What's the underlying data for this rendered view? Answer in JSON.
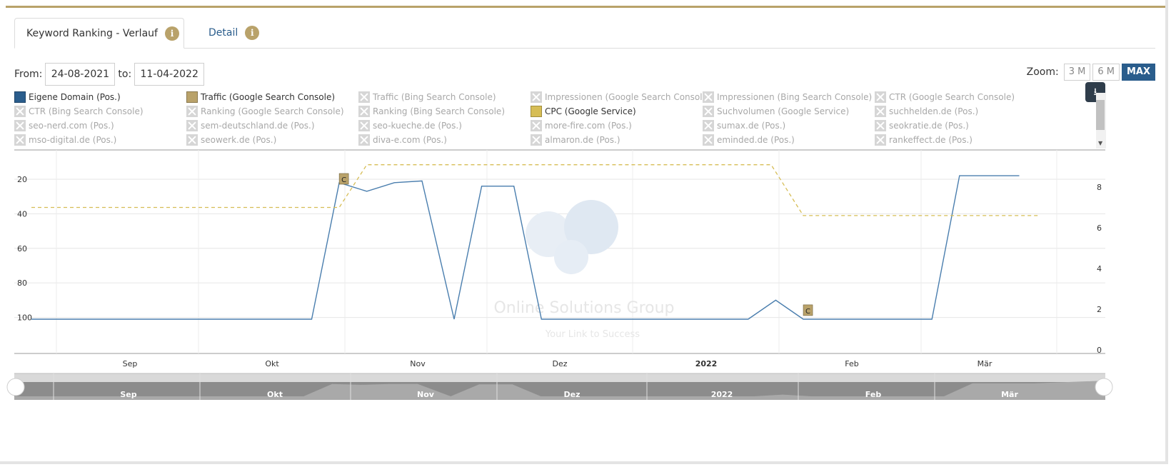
{
  "tabs": [
    {
      "label": "Keyword Ranking - Verlauf",
      "info": "i"
    },
    {
      "label": "Detail",
      "info": "i"
    }
  ],
  "dates": {
    "from_label": "From:",
    "from": "24-08-2021",
    "to_label": "to:",
    "to": "11-04-2022"
  },
  "zoom": {
    "label": "Zoom:",
    "options": [
      "3 M",
      "6 M",
      "MAX"
    ],
    "selected": "MAX"
  },
  "legend": [
    {
      "label": "Eigene Domain (Pos.)",
      "enabled": true,
      "color": "#2a5d8c"
    },
    {
      "label": "Traffic (Google Search Console)",
      "enabled": true,
      "color": "#b9a26a"
    },
    {
      "label": "Traffic (Bing Search Console)",
      "enabled": false
    },
    {
      "label": "Impressionen (Google Search Console)",
      "enabled": false
    },
    {
      "label": "Impressionen (Bing Search Console)",
      "enabled": false
    },
    {
      "label": "CTR (Google Search Console)",
      "enabled": false
    },
    {
      "label": "CTR (Bing Search Console)",
      "enabled": false
    },
    {
      "label": "Ranking (Google Search Console)",
      "enabled": false
    },
    {
      "label": "Ranking (Bing Search Console)",
      "enabled": false
    },
    {
      "label": "CPC (Google Service)",
      "enabled": true,
      "color": "#d6bd55"
    },
    {
      "label": "Suchvolumen (Google Service)",
      "enabled": false
    },
    {
      "label": "suchhelden.de (Pos.)",
      "enabled": false
    },
    {
      "label": "seo-nerd.com (Pos.)",
      "enabled": false
    },
    {
      "label": "sem-deutschland.de (Pos.)",
      "enabled": false
    },
    {
      "label": "seo-kueche.de (Pos.)",
      "enabled": false
    },
    {
      "label": "more-fire.com (Pos.)",
      "enabled": false
    },
    {
      "label": "sumax.de (Pos.)",
      "enabled": false
    },
    {
      "label": "seokratie.de (Pos.)",
      "enabled": false
    },
    {
      "label": "mso-digital.de (Pos.)",
      "enabled": false
    },
    {
      "label": "seowerk.de (Pos.)",
      "enabled": false
    },
    {
      "label": "diva-e.com (Pos.)",
      "enabled": false
    },
    {
      "label": "almaron.de (Pos.)",
      "enabled": false
    },
    {
      "label": "eminded.de (Pos.)",
      "enabled": false
    },
    {
      "label": "rankeffect.de (Pos.)",
      "enabled": false
    }
  ],
  "download_icon": "download-icon",
  "watermark": {
    "line1": "Online Solutions Group",
    "line2": "Your Link to Success"
  },
  "chart_data": {
    "type": "line",
    "x_axis": {
      "type": "date",
      "range": [
        "2021-08-24",
        "2022-04-11"
      ],
      "ticks": [
        "Sep",
        "Okt",
        "Nov",
        "Dez",
        "2022",
        "Feb",
        "Mär"
      ],
      "bold_ticks": [
        "2022"
      ]
    },
    "y_left": {
      "reversed": true,
      "range": [
        1,
        120
      ],
      "ticks": [
        20,
        40,
        60,
        80,
        100
      ]
    },
    "y_right": {
      "range": [
        0,
        9.5
      ],
      "ticks": [
        0,
        2,
        4,
        6,
        8
      ]
    },
    "series": [
      {
        "name": "Eigene Domain (Pos.)",
        "axis": "left",
        "color": "#4a7eae",
        "style": "solid",
        "points": [
          [
            "2021-08-24",
            101
          ],
          [
            "2021-10-24",
            101
          ],
          [
            "2021-10-30",
            22
          ],
          [
            "2021-11-05",
            27
          ],
          [
            "2021-11-11",
            22
          ],
          [
            "2021-11-17",
            21
          ],
          [
            "2021-11-24",
            101
          ],
          [
            "2021-11-30",
            24
          ],
          [
            "2021-12-07",
            24
          ],
          [
            "2021-12-13",
            101
          ],
          [
            "2022-01-27",
            101
          ],
          [
            "2022-02-02",
            90
          ],
          [
            "2022-02-08",
            101
          ],
          [
            "2022-03-08",
            101
          ],
          [
            "2022-03-14",
            18
          ],
          [
            "2022-03-27",
            18
          ]
        ]
      },
      {
        "name": "CPC (Google Service)",
        "axis": "right",
        "color": "#d6bd55",
        "style": "dashed",
        "points": [
          [
            "2021-08-24",
            7
          ],
          [
            "2021-10-30",
            7
          ],
          [
            "2021-11-05",
            9.1
          ],
          [
            "2022-02-01",
            9.1
          ],
          [
            "2022-02-08",
            6.6
          ],
          [
            "2022-03-31",
            6.6
          ]
        ]
      }
    ],
    "annotations": [
      {
        "label": "C",
        "date": "2021-10-30",
        "at": 20
      },
      {
        "label": "C",
        "date": "2022-02-08",
        "at": 96
      }
    ],
    "navigator": {
      "ticks": [
        "Sep",
        "Okt",
        "Nov",
        "Dez",
        "2022",
        "Feb",
        "Mär"
      ]
    }
  }
}
